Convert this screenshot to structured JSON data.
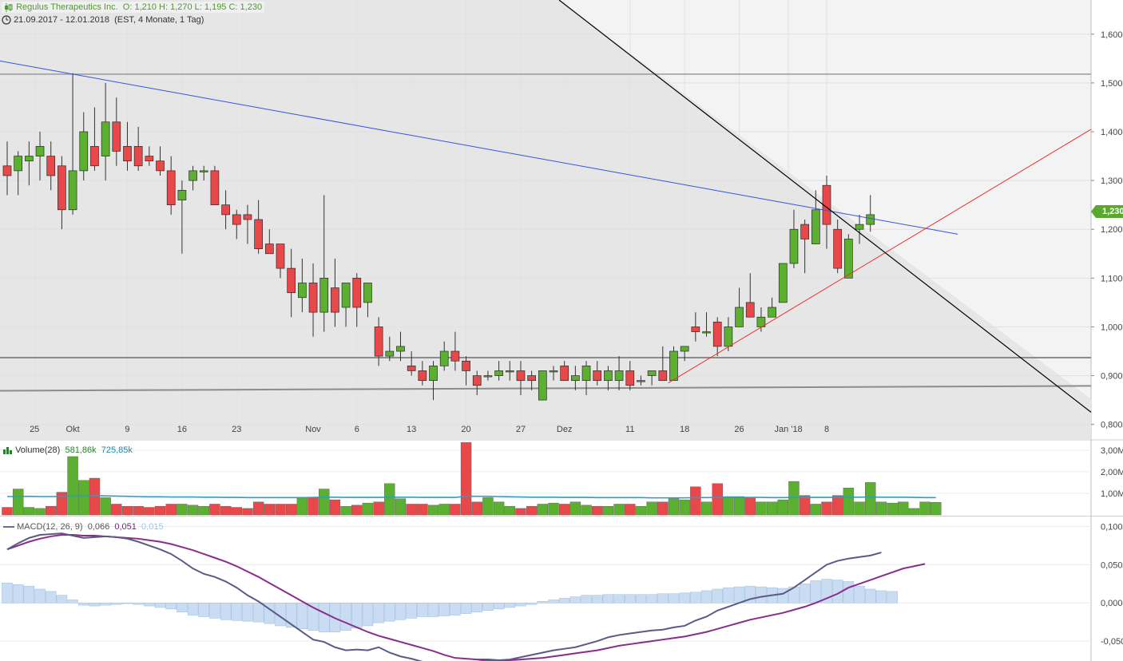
{
  "header": {
    "instrument": "Regulus Therapeutics Inc.",
    "ohlc": "O: 1,210  H: 1,270  L: 1,195  C: 1,230",
    "range": "21.09.2017 - 12.01.2018",
    "period": "(EST, 4 Monate, 1 Tag)",
    "last_price_tag": "1,230"
  },
  "colors": {
    "up": "#5cb030",
    "down": "#e8484a",
    "blue_trend": "#3355dd",
    "red_trend": "#e83030",
    "black_trend": "#000000",
    "volume_avg": "#2a9fc4",
    "macd": "#5a5a85",
    "signal": "#8b2c8b",
    "histogram": "#c9dcf2"
  },
  "chart_data": [
    {
      "type": "candlestick",
      "title": "Regulus Therapeutics Inc.",
      "ylim": [
        0.77,
        1.67
      ],
      "y_ticks": [
        "0,800",
        "0,900",
        "1,000",
        "1,100",
        "1,200",
        "1,300",
        "1,400",
        "1,500",
        "1,600"
      ],
      "x_tick_labels": [
        "25",
        "Okt",
        "9",
        "16",
        "23",
        "Nov",
        "6",
        "13",
        "20",
        "27",
        "Dez",
        "11",
        "18",
        "26",
        "Jan '18",
        "8"
      ],
      "candles": [
        [
          1.33,
          1.38,
          1.27,
          1.31
        ],
        [
          1.32,
          1.36,
          1.27,
          1.35
        ],
        [
          1.34,
          1.38,
          1.29,
          1.35
        ],
        [
          1.35,
          1.4,
          1.3,
          1.37
        ],
        [
          1.35,
          1.38,
          1.28,
          1.31
        ],
        [
          1.33,
          1.35,
          1.2,
          1.24
        ],
        [
          1.24,
          1.52,
          1.23,
          1.32
        ],
        [
          1.32,
          1.44,
          1.3,
          1.4
        ],
        [
          1.37,
          1.45,
          1.32,
          1.33
        ],
        [
          1.35,
          1.5,
          1.3,
          1.42
        ],
        [
          1.42,
          1.47,
          1.33,
          1.36
        ],
        [
          1.37,
          1.42,
          1.32,
          1.34
        ],
        [
          1.37,
          1.41,
          1.32,
          1.33
        ],
        [
          1.35,
          1.37,
          1.33,
          1.34
        ],
        [
          1.34,
          1.37,
          1.31,
          1.32
        ],
        [
          1.32,
          1.35,
          1.23,
          1.25
        ],
        [
          1.26,
          1.3,
          1.15,
          1.28
        ],
        [
          1.3,
          1.33,
          1.28,
          1.32
        ],
        [
          1.32,
          1.33,
          1.3,
          1.32
        ],
        [
          1.32,
          1.33,
          1.25,
          1.25
        ],
        [
          1.25,
          1.28,
          1.2,
          1.23
        ],
        [
          1.23,
          1.24,
          1.18,
          1.21
        ],
        [
          1.23,
          1.25,
          1.17,
          1.22
        ],
        [
          1.22,
          1.26,
          1.15,
          1.16
        ],
        [
          1.17,
          1.2,
          1.15,
          1.15
        ],
        [
          1.17,
          1.17,
          1.1,
          1.12
        ],
        [
          1.12,
          1.16,
          1.02,
          1.07
        ],
        [
          1.06,
          1.14,
          1.03,
          1.09
        ],
        [
          1.09,
          1.13,
          0.98,
          1.03
        ],
        [
          1.03,
          1.27,
          0.99,
          1.1
        ],
        [
          1.08,
          1.14,
          1.0,
          1.03
        ],
        [
          1.04,
          1.08,
          1.0,
          1.09
        ],
        [
          1.1,
          1.11,
          1.0,
          1.04
        ],
        [
          1.05,
          1.09,
          1.02,
          1.09
        ],
        [
          1.0,
          1.02,
          0.92,
          0.94
        ],
        [
          0.94,
          0.98,
          0.93,
          0.95
        ],
        [
          0.95,
          0.99,
          0.93,
          0.96
        ],
        [
          0.92,
          0.95,
          0.9,
          0.91
        ],
        [
          0.91,
          0.93,
          0.88,
          0.89
        ],
        [
          0.89,
          0.93,
          0.85,
          0.92
        ],
        [
          0.92,
          0.97,
          0.91,
          0.95
        ],
        [
          0.95,
          0.99,
          0.91,
          0.93
        ],
        [
          0.93,
          0.94,
          0.88,
          0.91
        ],
        [
          0.9,
          0.91,
          0.86,
          0.88
        ],
        [
          0.9,
          0.91,
          0.89,
          0.9
        ],
        [
          0.9,
          0.93,
          0.89,
          0.91
        ],
        [
          0.91,
          0.93,
          0.89,
          0.91
        ],
        [
          0.91,
          0.93,
          0.86,
          0.89
        ],
        [
          0.9,
          0.91,
          0.87,
          0.89
        ],
        [
          0.85,
          0.91,
          0.85,
          0.91
        ],
        [
          0.91,
          0.92,
          0.89,
          0.91
        ],
        [
          0.92,
          0.93,
          0.89,
          0.89
        ],
        [
          0.89,
          0.92,
          0.87,
          0.9
        ],
        [
          0.89,
          0.93,
          0.86,
          0.92
        ],
        [
          0.91,
          0.93,
          0.88,
          0.89
        ],
        [
          0.89,
          0.92,
          0.87,
          0.91
        ],
        [
          0.89,
          0.94,
          0.87,
          0.91
        ],
        [
          0.91,
          0.93,
          0.87,
          0.88
        ],
        [
          0.89,
          0.9,
          0.88,
          0.89
        ],
        [
          0.9,
          0.91,
          0.88,
          0.91
        ],
        [
          0.91,
          0.96,
          0.89,
          0.89
        ],
        [
          0.89,
          0.96,
          0.89,
          0.95
        ],
        [
          0.95,
          0.96,
          0.93,
          0.96
        ],
        [
          1.0,
          1.03,
          0.97,
          0.99
        ],
        [
          0.99,
          1.03,
          0.98,
          0.99
        ],
        [
          1.01,
          1.02,
          0.94,
          0.96
        ],
        [
          0.96,
          1.02,
          0.95,
          1.0
        ],
        [
          1.0,
          1.08,
          1.0,
          1.04
        ],
        [
          1.05,
          1.11,
          1.02,
          1.02
        ],
        [
          1.0,
          1.04,
          0.99,
          1.02
        ],
        [
          1.02,
          1.06,
          1.02,
          1.04
        ],
        [
          1.05,
          1.13,
          1.05,
          1.13
        ],
        [
          1.13,
          1.24,
          1.12,
          1.2
        ],
        [
          1.21,
          1.22,
          1.11,
          1.18
        ],
        [
          1.17,
          1.28,
          1.17,
          1.24
        ],
        [
          1.29,
          1.31,
          1.16,
          1.21
        ],
        [
          1.2,
          1.22,
          1.11,
          1.12
        ],
        [
          1.1,
          1.19,
          1.1,
          1.18
        ],
        [
          1.2,
          1.23,
          1.17,
          1.21
        ],
        [
          1.21,
          1.27,
          1.195,
          1.23
        ]
      ]
    },
    {
      "type": "bar",
      "title": "Volume(28)",
      "values_label": "581,86k",
      "avg_label": "725,85k",
      "ylim": [
        0,
        3.4
      ],
      "y_ticks": [
        "1,00M",
        "2,00M",
        "3,00M"
      ],
      "values": [
        0.35,
        1.2,
        0.35,
        0.3,
        0.4,
        1.05,
        2.7,
        1.6,
        1.7,
        0.8,
        0.5,
        0.4,
        0.4,
        0.35,
        0.4,
        0.5,
        0.5,
        0.45,
        0.4,
        0.5,
        0.4,
        0.35,
        0.3,
        0.6,
        0.5,
        0.5,
        0.5,
        0.8,
        0.8,
        1.2,
        0.7,
        0.4,
        0.45,
        0.55,
        0.6,
        1.45,
        0.75,
        0.5,
        0.5,
        0.45,
        0.5,
        0.5,
        3.35,
        0.6,
        0.8,
        0.6,
        0.4,
        0.3,
        0.4,
        0.5,
        0.55,
        0.5,
        0.6,
        0.45,
        0.4,
        0.4,
        0.5,
        0.5,
        0.4,
        0.6,
        0.6,
        0.75,
        0.7,
        1.3,
        0.6,
        1.45,
        0.85,
        0.85,
        0.8,
        0.6,
        0.6,
        0.7,
        1.55,
        0.9,
        0.5,
        0.6,
        0.9,
        1.25,
        0.6,
        1.5,
        0.6,
        0.55,
        0.6,
        0.3,
        0.6,
        0.58
      ],
      "avg": [
        0.85,
        0.85,
        0.86,
        0.85,
        0.85,
        0.86,
        0.87,
        0.88,
        0.89,
        0.88,
        0.87,
        0.86,
        0.85,
        0.84,
        0.84,
        0.83,
        0.83,
        0.83,
        0.82,
        0.82,
        0.81,
        0.81,
        0.8,
        0.8,
        0.8,
        0.8,
        0.8,
        0.8,
        0.81,
        0.82,
        0.82,
        0.81,
        0.81,
        0.81,
        0.81,
        0.82,
        0.82,
        0.82,
        0.81,
        0.81,
        0.81,
        0.81,
        0.86,
        0.86,
        0.86,
        0.85,
        0.84,
        0.83,
        0.82,
        0.82,
        0.82,
        0.81,
        0.81,
        0.81,
        0.8,
        0.8,
        0.8,
        0.8,
        0.8,
        0.79,
        0.79,
        0.79,
        0.79,
        0.8,
        0.8,
        0.81,
        0.81,
        0.81,
        0.81,
        0.81,
        0.8,
        0.8,
        0.81,
        0.81,
        0.81,
        0.81,
        0.81,
        0.82,
        0.82,
        0.83,
        0.82,
        0.82,
        0.82,
        0.81,
        0.8,
        0.8
      ]
    },
    {
      "type": "line",
      "title": "MACD(12, 26, 9)",
      "value_labels": [
        "0,066",
        "0,051",
        "0,015"
      ],
      "ylim": [
        -0.076,
        0.112
      ],
      "y_ticks": [
        "-0,050",
        "0,000",
        "0,050",
        "0,100"
      ],
      "macd": [
        0.07,
        0.078,
        0.085,
        0.089,
        0.09,
        0.091,
        0.088,
        0.085,
        0.086,
        0.087,
        0.086,
        0.084,
        0.08,
        0.075,
        0.07,
        0.064,
        0.055,
        0.045,
        0.038,
        0.034,
        0.028,
        0.02,
        0.01,
        0.002,
        -0.008,
        -0.018,
        -0.028,
        -0.038,
        -0.048,
        -0.051,
        -0.058,
        -0.062,
        -0.061,
        -0.062,
        -0.058,
        -0.065,
        -0.07,
        -0.073,
        -0.077,
        -0.082,
        -0.084,
        -0.083,
        -0.079,
        -0.077,
        -0.075,
        -0.075,
        -0.074,
        -0.071,
        -0.068,
        -0.065,
        -0.062,
        -0.06,
        -0.058,
        -0.054,
        -0.05,
        -0.045,
        -0.042,
        -0.04,
        -0.038,
        -0.036,
        -0.035,
        -0.032,
        -0.03,
        -0.023,
        -0.018,
        -0.01,
        -0.005,
        0.0,
        0.005,
        0.008,
        0.01,
        0.012,
        0.02,
        0.03,
        0.04,
        0.05,
        0.055,
        0.058,
        0.06,
        0.062,
        0.066
      ],
      "signal": [
        0.07,
        0.075,
        0.08,
        0.084,
        0.087,
        0.089,
        0.089,
        0.088,
        0.088,
        0.087,
        0.086,
        0.085,
        0.084,
        0.082,
        0.08,
        0.077,
        0.073,
        0.069,
        0.064,
        0.059,
        0.054,
        0.048,
        0.041,
        0.034,
        0.026,
        0.018,
        0.01,
        0.002,
        -0.006,
        -0.013,
        -0.02,
        -0.026,
        -0.032,
        -0.038,
        -0.043,
        -0.047,
        -0.051,
        -0.055,
        -0.059,
        -0.063,
        -0.068,
        -0.072,
        -0.073,
        -0.074,
        -0.074,
        -0.075,
        -0.075,
        -0.074,
        -0.073,
        -0.072,
        -0.07,
        -0.068,
        -0.066,
        -0.064,
        -0.062,
        -0.059,
        -0.056,
        -0.054,
        -0.052,
        -0.05,
        -0.048,
        -0.046,
        -0.044,
        -0.041,
        -0.038,
        -0.034,
        -0.03,
        -0.026,
        -0.022,
        -0.019,
        -0.016,
        -0.013,
        -0.009,
        -0.005,
        0.0,
        0.006,
        0.012,
        0.02,
        0.025,
        0.03,
        0.035,
        0.04,
        0.045,
        0.048,
        0.051
      ],
      "histogram": [
        0.026,
        0.024,
        0.022,
        0.018,
        0.015,
        0.01,
        0.004,
        -0.003,
        -0.004,
        -0.003,
        -0.002,
        0.0,
        -0.002,
        -0.004,
        -0.006,
        -0.008,
        -0.012,
        -0.016,
        -0.018,
        -0.02,
        -0.022,
        -0.023,
        -0.024,
        -0.025,
        -0.027,
        -0.03,
        -0.032,
        -0.034,
        -0.036,
        -0.038,
        -0.038,
        -0.036,
        -0.033,
        -0.03,
        -0.026,
        -0.024,
        -0.022,
        -0.02,
        -0.018,
        -0.018,
        -0.017,
        -0.016,
        -0.014,
        -0.012,
        -0.01,
        -0.008,
        -0.006,
        -0.004,
        -0.002,
        0.002,
        0.004,
        0.006,
        0.008,
        0.01,
        0.01,
        0.011,
        0.011,
        0.011,
        0.011,
        0.011,
        0.012,
        0.012,
        0.013,
        0.014,
        0.016,
        0.018,
        0.02,
        0.021,
        0.022,
        0.021,
        0.02,
        0.019,
        0.021,
        0.025,
        0.029,
        0.031,
        0.03,
        0.028,
        0.022,
        0.018,
        0.016,
        0.015
      ]
    }
  ]
}
